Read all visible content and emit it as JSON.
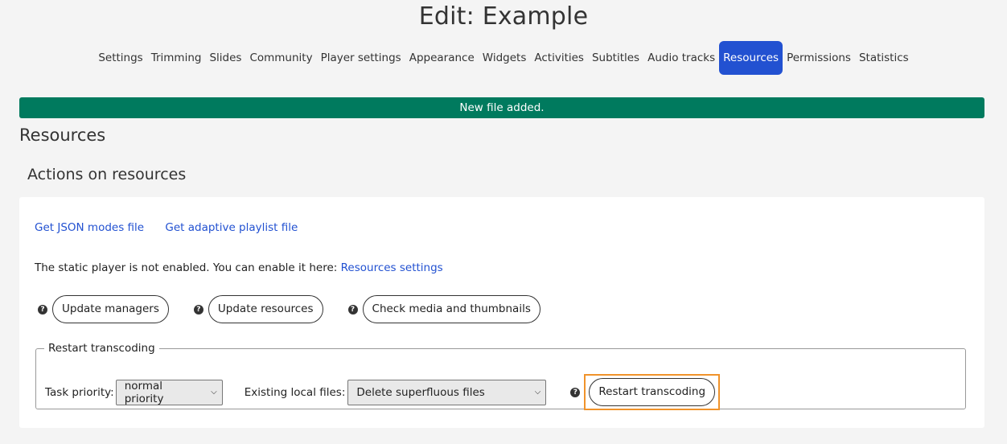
{
  "title": "Edit: Example",
  "tabs": [
    {
      "label": "Settings",
      "active": false
    },
    {
      "label": "Trimming",
      "active": false
    },
    {
      "label": "Slides",
      "active": false
    },
    {
      "label": "Community",
      "active": false
    },
    {
      "label": "Player settings",
      "active": false
    },
    {
      "label": "Appearance",
      "active": false
    },
    {
      "label": "Widgets",
      "active": false
    },
    {
      "label": "Activities",
      "active": false
    },
    {
      "label": "Subtitles",
      "active": false
    },
    {
      "label": "Audio tracks",
      "active": false
    },
    {
      "label": "Resources",
      "active": true
    },
    {
      "label": "Permissions",
      "active": false
    },
    {
      "label": "Statistics",
      "active": false
    }
  ],
  "alert": {
    "text": "New file added.",
    "color": "#007a5e"
  },
  "section_title": "Resources",
  "actions_title": "Actions on resources",
  "links": {
    "json_modes": "Get JSON modes file",
    "adaptive_playlist": "Get adaptive playlist file"
  },
  "static_note": {
    "text": "The static player is not enabled. You can enable it here:",
    "link": "Resources settings"
  },
  "buttons": {
    "help_icon": "question-circle-icon",
    "update_managers": "Update managers",
    "update_resources": "Update resources",
    "check_media": "Check media and thumbnails"
  },
  "transcoding": {
    "legend": "Restart transcoding",
    "priority_label": "Task priority:",
    "priority_value": "normal priority",
    "files_label": "Existing local files:",
    "files_value": "Delete superfluous files",
    "button": "Restart transcoding"
  },
  "colors": {
    "accent": "#2251d1",
    "highlight": "#f0932b"
  }
}
